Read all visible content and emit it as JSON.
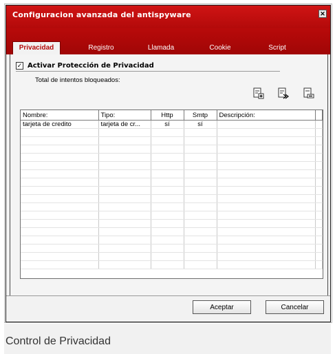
{
  "window": {
    "title": "Configuracion avanzada del antispyware"
  },
  "tabs": [
    {
      "label": "Privacidad",
      "active": true
    },
    {
      "label": "Registro",
      "active": false
    },
    {
      "label": "Llamada",
      "active": false
    },
    {
      "label": "Cookie",
      "active": false
    },
    {
      "label": "Script",
      "active": false
    }
  ],
  "privacy": {
    "checkbox_label": "Activar Protección de Privacidad",
    "checked": true,
    "blocked_label": "Total de intentos bloqueados:"
  },
  "toolbar": {
    "icons": [
      "add-rule-icon",
      "edit-rule-icon",
      "delete-rule-icon"
    ]
  },
  "table": {
    "columns": [
      "Nombre:",
      "Tipo:",
      "Http",
      "Smtp",
      "Descripción:"
    ],
    "rows": [
      [
        "tarjeta de credito",
        "tarjeta de cr...",
        "sí",
        "sí",
        ""
      ]
    ]
  },
  "buttons": {
    "accept": "Aceptar",
    "cancel": "Cancelar"
  },
  "caption": "Control de Privacidad",
  "colors": {
    "title_red": "#c00f0f",
    "tab_active_text": "#b30a0a"
  }
}
